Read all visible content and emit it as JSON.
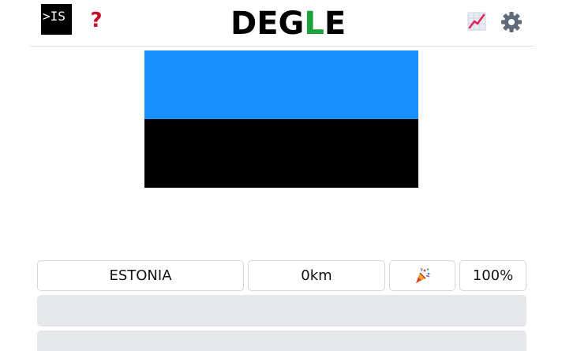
{
  "header": {
    "logo_text": ">IS",
    "help_label": "?",
    "title_parts": [
      "DEG",
      "L",
      "E"
    ],
    "title_accent_color": "#1aa33a",
    "stats_icon": "chart-icon",
    "settings_icon": "gear-icon"
  },
  "flag": {
    "country": "Estonia",
    "stripes": [
      "#1891ff",
      "#000000"
    ]
  },
  "guesses": [
    {
      "country": "ESTONIA",
      "distance": "0km",
      "direction_icon": "party-popper-icon",
      "proximity": "100%"
    }
  ],
  "empty_guess_rows": 2
}
